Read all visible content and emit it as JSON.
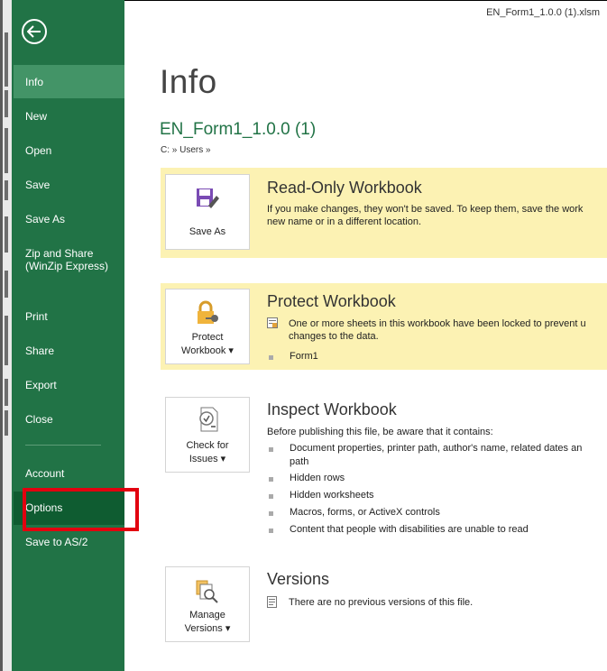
{
  "title_bar": {
    "filename": "EN_Form1_1.0.0 (1).xlsm"
  },
  "nav": {
    "back_label": "Back",
    "items": [
      "Info",
      "New",
      "Open",
      "Save",
      "Save As",
      "Zip and Share (WinZip Express)",
      "Print",
      "Share",
      "Export",
      "Close",
      "Account",
      "Options",
      "Save to AS/2"
    ],
    "active": "Info",
    "highlighted": "Options"
  },
  "main": {
    "title": "Info",
    "doc_name": "EN_Form1_1.0.0 (1)",
    "path": "C: » Users »",
    "readonly": {
      "button_label": "Save As",
      "title": "Read-Only Workbook",
      "line1": "If you make changes, they won't be saved. To keep them, save the work",
      "line2": "new name or in a different location."
    },
    "protect": {
      "button_line1": "Protect",
      "button_line2": "Workbook ▾",
      "title": "Protect Workbook",
      "line1": "One or more sheets in this workbook have been locked to prevent u",
      "line2": "changes to the data.",
      "items": [
        "Form1"
      ]
    },
    "inspect": {
      "button_line1": "Check for",
      "button_line2": "Issues ▾",
      "title": "Inspect Workbook",
      "intro": "Before publishing this file, be aware that it contains:",
      "items": [
        "Document properties, printer path, author's name, related dates an",
        "path",
        "Hidden rows",
        "Hidden worksheets",
        "Macros, forms, or ActiveX controls",
        "Content that people with disabilities are unable to read"
      ]
    },
    "versions": {
      "button_line1": "Manage",
      "button_line2": "Versions ▾",
      "title": "Versions",
      "text": "There are no previous versions of this file."
    }
  },
  "colors": {
    "sidebar": "#217346",
    "active": "#439467",
    "hover": "#0f5c31",
    "highlight": "#e2000f",
    "notice": "#fcf2b3"
  }
}
